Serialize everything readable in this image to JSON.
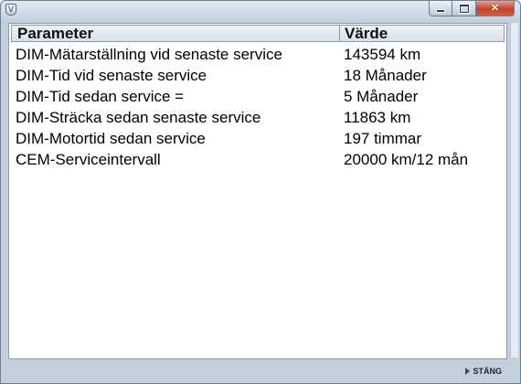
{
  "window": {
    "title": "",
    "app_icon": "shield-icon",
    "caption_buttons": {
      "minimize": "minimize-icon",
      "maximize": "maximize-icon",
      "close": "close-icon"
    }
  },
  "table": {
    "columns": [
      "Parameter",
      "Värde"
    ],
    "rows": [
      {
        "parameter": "DIM-Mätarställning vid senaste service",
        "value": "143594 km"
      },
      {
        "parameter": "DIM-Tid vid senaste service",
        "value": "18 Månader"
      },
      {
        "parameter": "DIM-Tid sedan service =",
        "value": "5 Månader"
      },
      {
        "parameter": "DIM-Sträcka sedan senaste service",
        "value": "11863 km"
      },
      {
        "parameter": "DIM-Motortid sedan service",
        "value": "197 timmar"
      },
      {
        "parameter": "CEM-Serviceintervall",
        "value": "20000 km/12 mån"
      }
    ]
  },
  "footer": {
    "close_label": "STÄNG",
    "close_icon": "play-arrow-icon"
  },
  "colors": {
    "window_frame": "#c3d0dc",
    "header_bg": "#e4eaf0",
    "close_button": "#c4412b"
  }
}
